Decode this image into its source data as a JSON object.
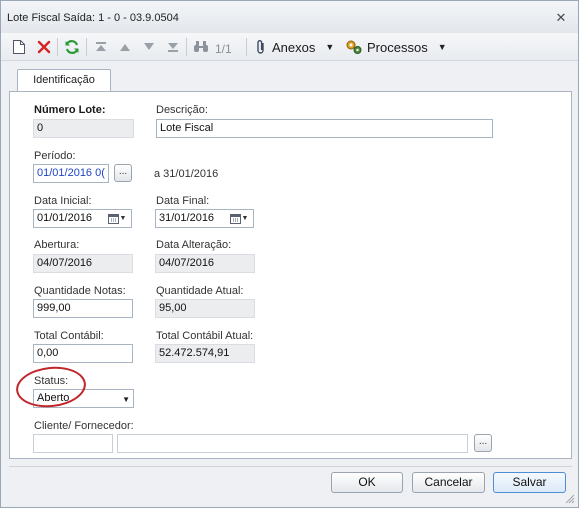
{
  "window": {
    "title": "Lote Fiscal Saída: 1 - 0 - 03.9.0504"
  },
  "toolbar": {
    "pager": "1/1",
    "anexos_label": "Anexos",
    "processos_label": "Processos"
  },
  "tabs": [
    {
      "label": "Identificação"
    }
  ],
  "form": {
    "numero_lote": {
      "label": "Número Lote:",
      "value": "0"
    },
    "descricao": {
      "label": "Descrição:",
      "value": "Lote Fiscal"
    },
    "periodo": {
      "label": "Período:",
      "value": "01/01/2016 0(",
      "button": "...",
      "suffix": "a 31/01/2016"
    },
    "data_inicial": {
      "label": "Data Inicial:",
      "value": "01/01/2016"
    },
    "data_final": {
      "label": "Data Final:",
      "value": "31/01/2016"
    },
    "abertura": {
      "label": "Abertura:",
      "value": "04/07/2016"
    },
    "data_alteracao": {
      "label": "Data Alteração:",
      "value": "04/07/2016"
    },
    "quantidade_notas": {
      "label": "Quantidade Notas:",
      "value": "999,00"
    },
    "quantidade_atual": {
      "label": "Quantidade Atual:",
      "value": "95,00"
    },
    "total_contabil": {
      "label": "Total Contábil:",
      "value": "0,00"
    },
    "total_contabil_atual": {
      "label": "Total Contábil Atual:",
      "value": "52.472.574,91"
    },
    "status": {
      "label": "Status:",
      "value": "Aberto"
    },
    "cliente_fornecedor": {
      "label": "Cliente/ Fornecedor:",
      "code": "",
      "name": "",
      "button": "..."
    }
  },
  "footer": {
    "ok_label": "OK",
    "cancel_label": "Cancelar",
    "save_label": "Salvar"
  },
  "colors": {
    "annotation_circle": "#c0262a",
    "period_text": "#1d44c8",
    "primary_button_border": "#4d8fd6"
  },
  "icons": [
    "new-document-icon",
    "delete-icon",
    "refresh-icon",
    "first-record-icon",
    "previous-record-icon",
    "next-record-icon",
    "last-record-icon",
    "binoculars-icon",
    "paperclip-icon",
    "gears-icon",
    "calendar-icon",
    "close-icon"
  ]
}
